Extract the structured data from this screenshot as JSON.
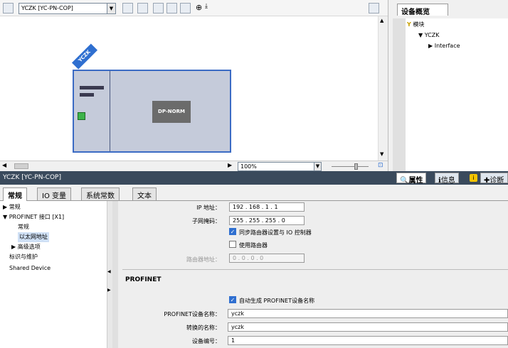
{
  "toolbar": {
    "device_select": "YCZK [YC-PN-COP]"
  },
  "canvas": {
    "device_tag": "YCZK",
    "module_label": "DP-NORM",
    "zoom": "100%"
  },
  "overview": {
    "tab": "设备概览",
    "header": "模块",
    "items": [
      "YCZK",
      "Interface"
    ]
  },
  "properties": {
    "title": "YCZK [YC-PN-COP]",
    "tabs": [
      "属性",
      "信息",
      "诊断"
    ],
    "info_badge": "i"
  },
  "tabs": [
    "常规",
    "IO 变量",
    "系统常数",
    "文本"
  ],
  "nav": [
    "常规",
    "PROFINET 接口 [X1]",
    "常规",
    "以太网地址",
    "高级选项",
    "标识与维护",
    "Shared Device"
  ],
  "ip": {
    "ip_label": "IP 地址：",
    "ip_value": "192 . 168 . 1 . 1",
    "mask_label": "子网掩码：",
    "mask_value": "255 . 255 . 255 . 0",
    "sync_router": "同步路由器设置与 IO 控制器",
    "use_router": "使用路由器",
    "router_label": "路由器地址：",
    "router_value": "0 . 0 . 0 . 0"
  },
  "profinet": {
    "heading": "PROFINET",
    "auto_name": "自动生成 PROFINET设备名称",
    "name_label": "PROFINET设备名称：",
    "name_value": "yczk",
    "conv_label": "转换的名称：",
    "conv_value": "yczk",
    "num_label": "设备编号：",
    "num_value": "1"
  }
}
